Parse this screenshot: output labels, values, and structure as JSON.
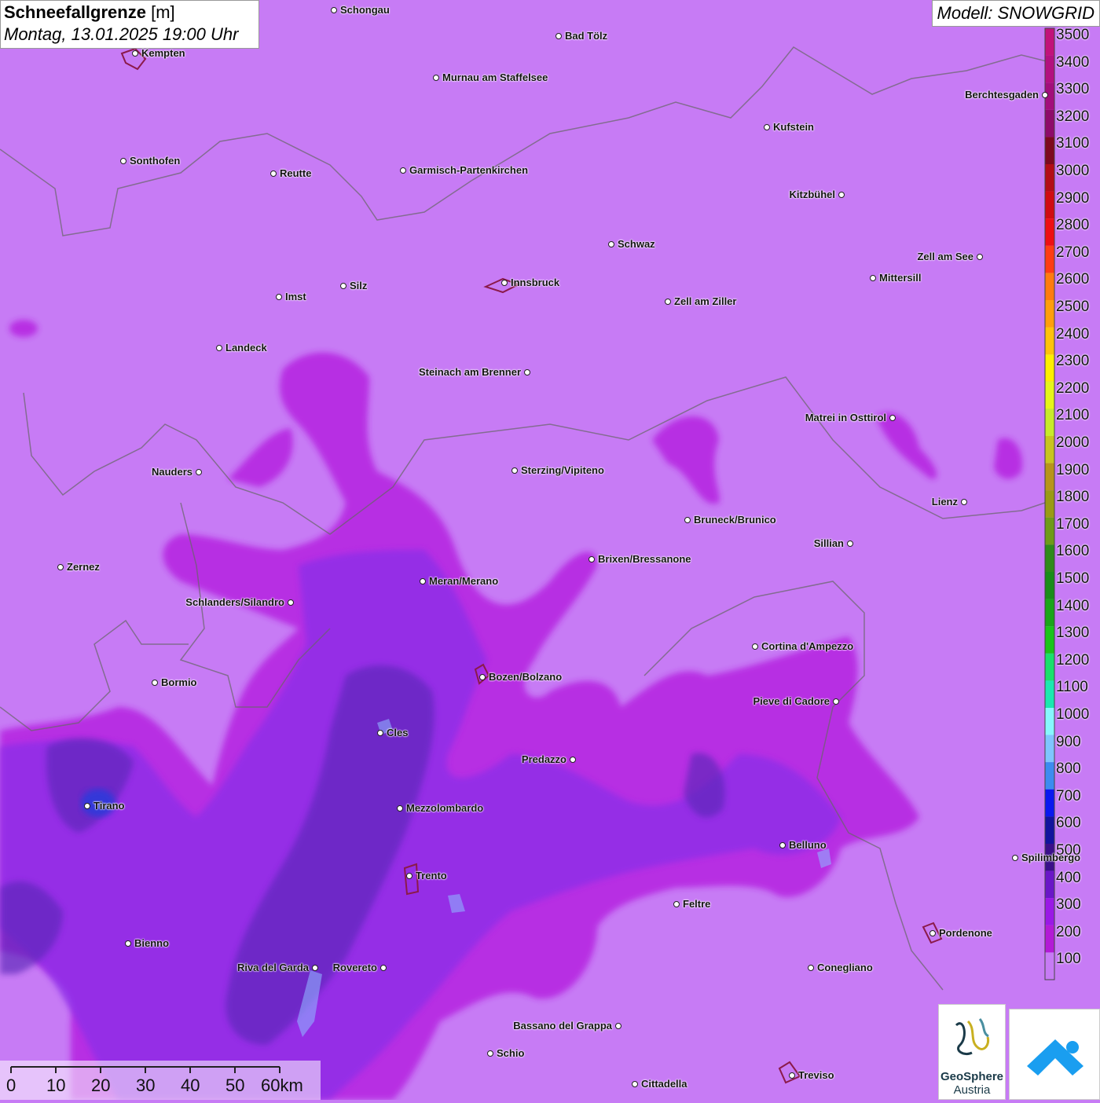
{
  "title": {
    "parameter": "Schneefallgrenze",
    "unit": "[m]",
    "datetime": "Montag, 13.01.2025 19:00 Uhr"
  },
  "model": "Modell: SNOWGRID",
  "legend": {
    "labels": [
      "3500",
      "3400",
      "3300",
      "3200",
      "3100",
      "3000",
      "2900",
      "2800",
      "2700",
      "2600",
      "2500",
      "2400",
      "2300",
      "2200",
      "2100",
      "2000",
      "1900",
      "1800",
      "1700",
      "1600",
      "1500",
      "1400",
      "1300",
      "1200",
      "1100",
      "1000",
      "900",
      "800",
      "700",
      "600",
      "500",
      "400",
      "300",
      "200",
      "100"
    ],
    "colors": [
      "#c2127a",
      "#b3107f",
      "#a30e7c",
      "#8e0b6a",
      "#7d0a1e",
      "#b30d16",
      "#d00b12",
      "#ee0f13",
      "#ff3c14",
      "#ff7b0f",
      "#ff9e0c",
      "#ffc20a",
      "#ffee00",
      "#e6f51a",
      "#c8ea2a",
      "#c8c41f",
      "#b8941a",
      "#9a9a15",
      "#6f9a18",
      "#2f8a1a",
      "#1a8c1a",
      "#1aa51a",
      "#1ac41a",
      "#19e06b",
      "#1ae8b0",
      "#87f7ff",
      "#7fc5ff",
      "#3c8bf0",
      "#0a18f0",
      "#12149e",
      "#3a0f8a",
      "#6a16c8",
      "#9a18e6",
      "#b31ad6",
      "#c77bf5"
    ]
  },
  "cities": [
    {
      "name": "Schongau"
    },
    {
      "name": "Bad Tölz"
    },
    {
      "name": "Kempten"
    },
    {
      "name": "Murnau am Staffelsee"
    },
    {
      "name": "Berchtesgaden"
    },
    {
      "name": "Kufstein"
    },
    {
      "name": "Sonthofen"
    },
    {
      "name": "Reutte"
    },
    {
      "name": "Garmisch-Partenkirchen"
    },
    {
      "name": "Kitzbühel"
    },
    {
      "name": "Schwaz"
    },
    {
      "name": "Zell am See"
    },
    {
      "name": "Innsbruck"
    },
    {
      "name": "Mittersill"
    },
    {
      "name": "Imst"
    },
    {
      "name": "Silz"
    },
    {
      "name": "Zell am Ziller"
    },
    {
      "name": "Landeck"
    },
    {
      "name": "Steinach am Brenner"
    },
    {
      "name": "Matrei in Osttirol"
    },
    {
      "name": "Nauders"
    },
    {
      "name": "Sterzing/Vipiteno"
    },
    {
      "name": "Lienz"
    },
    {
      "name": "Bruneck/Brunico"
    },
    {
      "name": "Sillian"
    },
    {
      "name": "Zernez"
    },
    {
      "name": "Brixen/Bressanone"
    },
    {
      "name": "Meran/Merano"
    },
    {
      "name": "Schlanders/Silandro"
    },
    {
      "name": "Cortina d'Ampezzo"
    },
    {
      "name": "Bormio"
    },
    {
      "name": "Bozen/Bolzano"
    },
    {
      "name": "Pieve di Cadore"
    },
    {
      "name": "Cles"
    },
    {
      "name": "Predazzo"
    },
    {
      "name": "Tirano"
    },
    {
      "name": "Mezzolombardo"
    },
    {
      "name": "Belluno"
    },
    {
      "name": "Spilimbergo"
    },
    {
      "name": "Trento"
    },
    {
      "name": "Feltre"
    },
    {
      "name": "Pordenone"
    },
    {
      "name": "Bienno"
    },
    {
      "name": "Riva del Garda"
    },
    {
      "name": "Rovereto"
    },
    {
      "name": "Conegliano"
    },
    {
      "name": "Bassano del Grappa"
    },
    {
      "name": "Schio"
    },
    {
      "name": "Treviso"
    },
    {
      "name": "Cittadella"
    }
  ],
  "scale": {
    "labels": [
      "0",
      "10",
      "20",
      "30",
      "40",
      "50",
      "60km"
    ]
  },
  "logos": {
    "geosphere_line1": "GeoSphere",
    "geosphere_line2": "Austria"
  }
}
